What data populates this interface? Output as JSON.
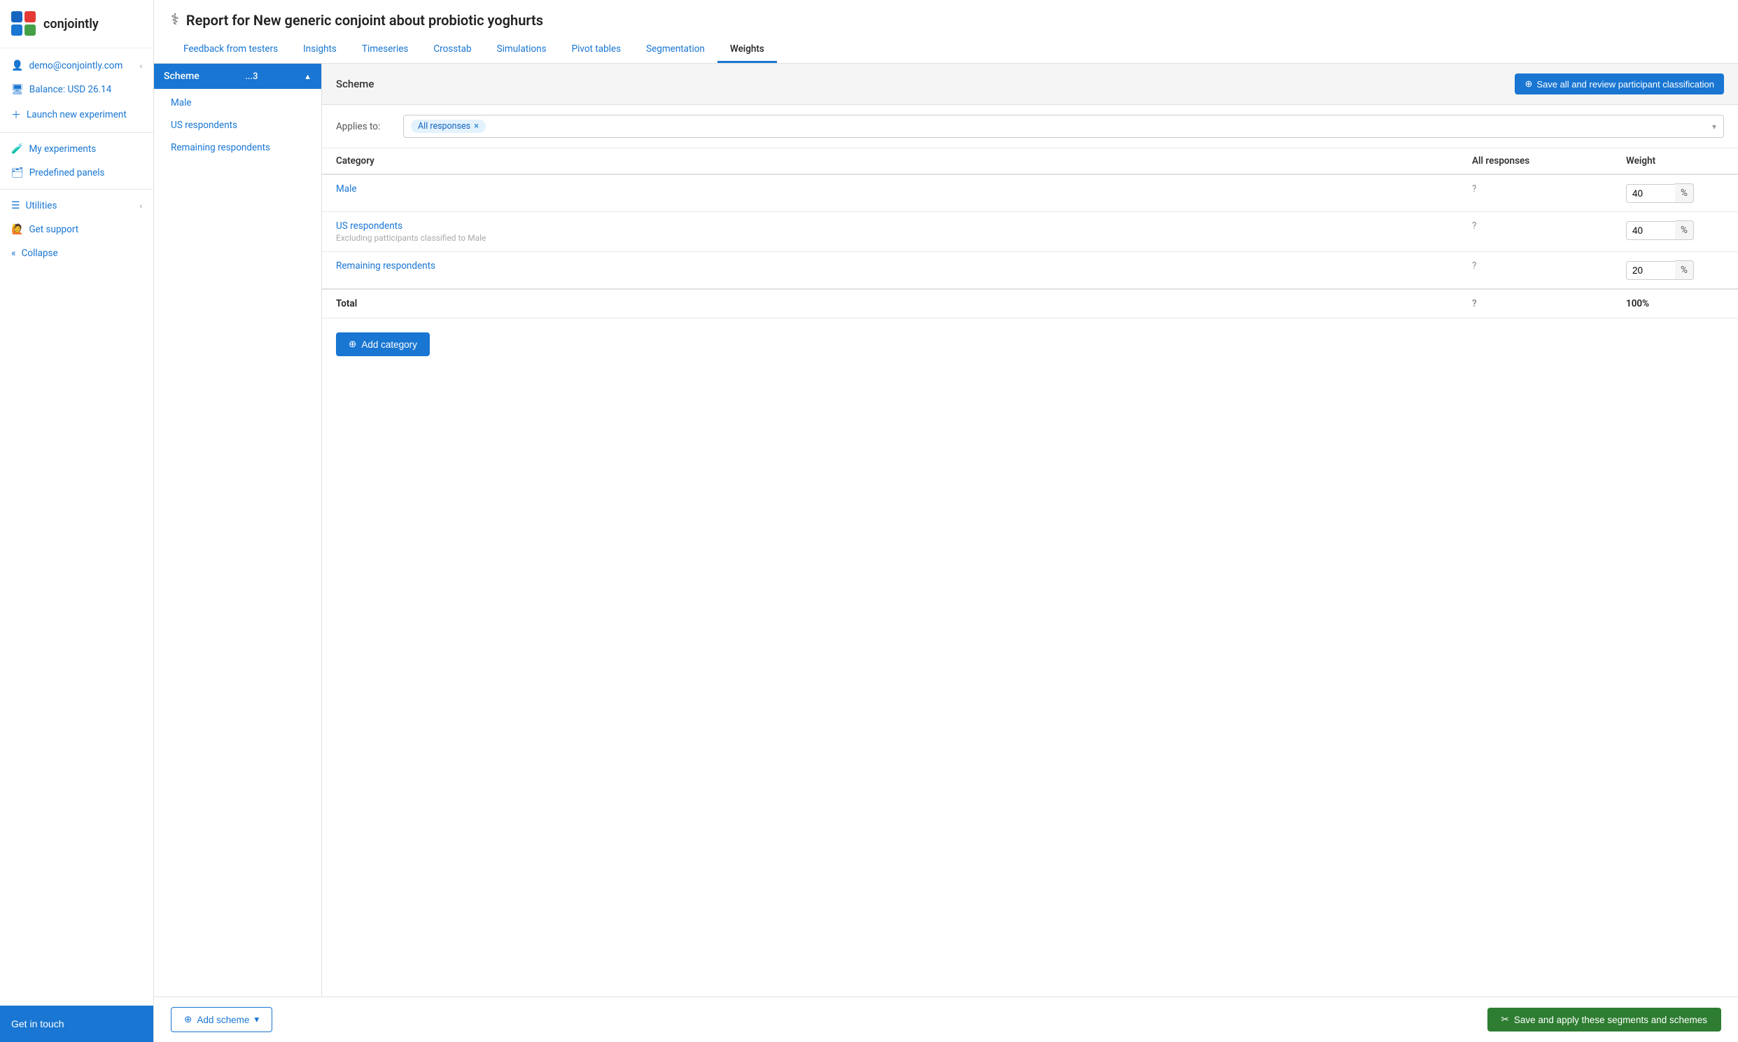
{
  "logo": {
    "text": "conjointly"
  },
  "sidebar": {
    "user": "demo@conjointly.com",
    "balance": "Balance: USD 26.14",
    "launch": "Launch new experiment",
    "my_experiments": "My experiments",
    "predefined_panels": "Predefined panels",
    "utilities": "Utilities",
    "get_support": "Get support",
    "collapse": "Collapse",
    "get_in_touch": "Get in touch"
  },
  "header": {
    "title_icon": "⚕",
    "title": "Report for New generic conjoint about probiotic yoghurts",
    "tabs": [
      {
        "label": "Feedback from testers",
        "active": false
      },
      {
        "label": "Insights",
        "active": false
      },
      {
        "label": "Timeseries",
        "active": false
      },
      {
        "label": "Crosstab",
        "active": false
      },
      {
        "label": "Simulations",
        "active": false
      },
      {
        "label": "Pivot tables",
        "active": false
      },
      {
        "label": "Segmentation",
        "active": false
      },
      {
        "label": "Weights",
        "active": true
      }
    ]
  },
  "left_panel": {
    "scheme_label": "Scheme",
    "scheme_count": "...3",
    "sub_items": [
      {
        "label": "Male"
      },
      {
        "label": "US respondents"
      },
      {
        "label": "Remaining respondents"
      }
    ]
  },
  "right_panel": {
    "scheme_title": "Scheme",
    "save_review_label": "Save all and review participant classification",
    "applies_to_label": "Applies to:",
    "applies_to_tag": "All responses",
    "table": {
      "columns": [
        "Category",
        "All responses",
        "Weight"
      ],
      "rows": [
        {
          "category": "Male",
          "sub": "",
          "all_responses": "?",
          "weight": "40"
        },
        {
          "category": "US respondents",
          "sub": "Excluding patticipants classified to Male",
          "all_responses": "?",
          "weight": "40"
        },
        {
          "category": "Remaining respondents",
          "sub": "",
          "all_responses": "?",
          "weight": "20"
        }
      ],
      "total_label": "Total",
      "total_responses": "?",
      "total_weight": "100%"
    },
    "add_category_label": "Add category"
  },
  "bottom_bar": {
    "add_scheme_label": "Add scheme",
    "save_apply_label": "Save and apply these segments and schemes"
  }
}
